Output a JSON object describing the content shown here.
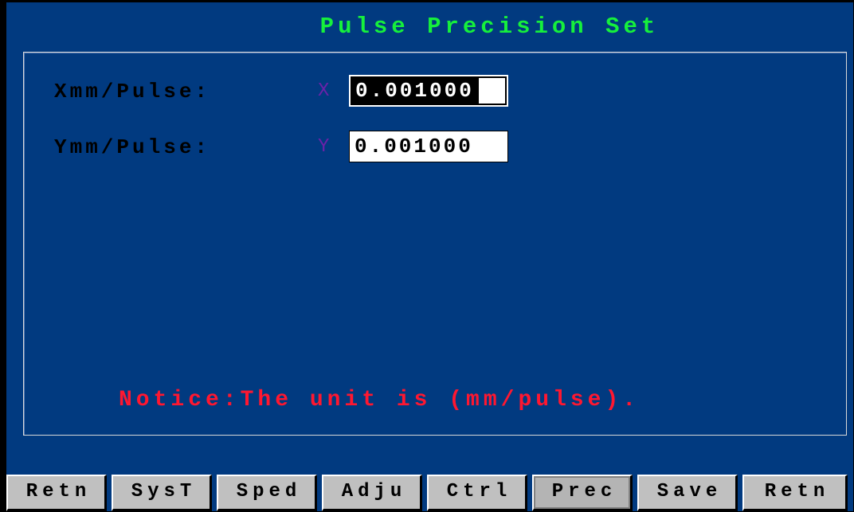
{
  "title": "Pulse Precision Set",
  "fields": [
    {
      "label": "Xmm/Pulse:",
      "axis": "X",
      "value": "0.001000",
      "selected": true
    },
    {
      "label": "Ymm/Pulse:",
      "axis": "Y",
      "value": "0.001000",
      "selected": false
    }
  ],
  "notice": "Notice:The unit is (mm/pulse).",
  "toolbar": [
    {
      "label": "Retn",
      "active": false
    },
    {
      "label": "SysT",
      "active": false
    },
    {
      "label": "Sped",
      "active": false
    },
    {
      "label": "Adju",
      "active": false
    },
    {
      "label": "Ctrl",
      "active": false
    },
    {
      "label": "Prec",
      "active": true
    },
    {
      "label": "Save",
      "active": false
    },
    {
      "label": "Retn",
      "active": false
    }
  ],
  "colors": {
    "background": "#013a80",
    "title": "#16f03c",
    "notice": "#ff1730",
    "axis_letter": "#6a22a8",
    "button_face": "#c0c0c0"
  }
}
